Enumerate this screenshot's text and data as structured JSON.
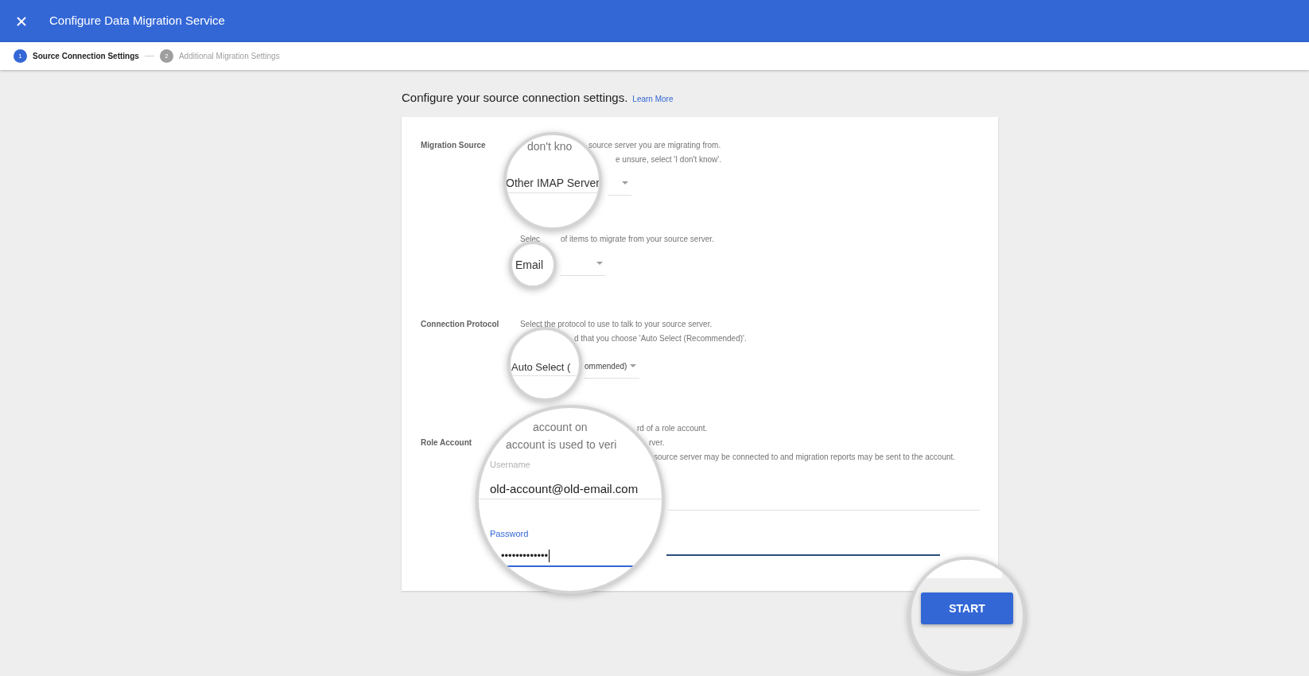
{
  "window": {
    "title": "Configure Data Migration Service"
  },
  "steps": [
    {
      "number": "1",
      "label": "Source Connection Settings",
      "selected": true
    },
    {
      "number": "2",
      "label": "Additional Migration Settings",
      "selected": false
    }
  ],
  "heading": "Configure your source connection settings.",
  "learn_more": "Learn More",
  "migration_source": {
    "label": "Migration Source",
    "magnified_text": "don't kno",
    "hint_lines": [
      "source server you are migrating from.",
      "e unsure, select 'I don't know'."
    ],
    "server_select": {
      "value": "Other IMAP Server"
    },
    "items_hint": [
      "Selec",
      "of items to migrate from your source server."
    ],
    "items_select": {
      "value": "Email"
    }
  },
  "connection_protocol": {
    "label": "Connection Protocol",
    "hint_lines": [
      "Select the protocol to use to talk to your source server.",
      "d that you choose 'Auto Select (Recommended)'."
    ],
    "protocol_select": {
      "value_magnified": "Auto Select (",
      "value_rest": "ommended)"
    }
  },
  "role_account": {
    "label": "Role Account",
    "magnified_lines": [
      "account on",
      "account is used to veri"
    ],
    "hint_lines": [
      "rd of a role account.",
      "rver.",
      "source server may be connected to and migration reports may be sent to the account."
    ],
    "username": {
      "label": "Username",
      "value": "old-account@old-email.com",
      "focused": false
    },
    "password": {
      "label": "Password",
      "value": "•••••••••••••",
      "focused": true
    }
  },
  "start_button": "START"
}
